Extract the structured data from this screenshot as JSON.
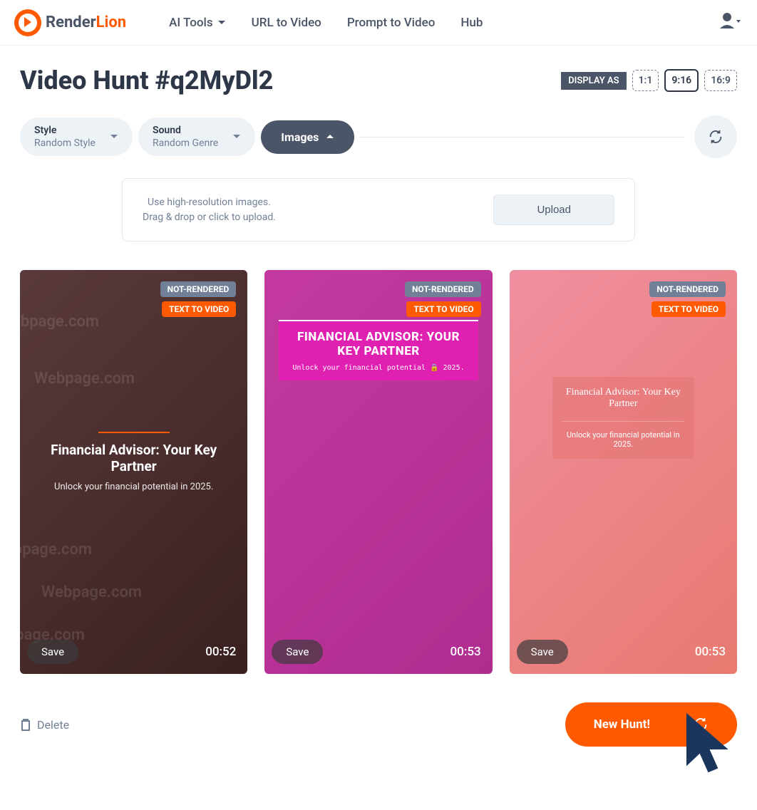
{
  "header": {
    "logo_render": "Render",
    "logo_lion": "Lion",
    "nav": [
      "AI Tools",
      "URL to Video",
      "Prompt to Video",
      "Hub"
    ]
  },
  "title": "Video Hunt #q2MyDl2",
  "display_as_label": "DISPLAY AS",
  "ratios": [
    "1:1",
    "9:16",
    "16:9"
  ],
  "filters": {
    "style_label": "Style",
    "style_value": "Random Style",
    "sound_label": "Sound",
    "sound_value": "Random Genre",
    "images_label": "Images"
  },
  "upload": {
    "line1": "Use high-resolution images.",
    "line2": "Drag & drop or click to upload.",
    "button": "Upload"
  },
  "cards": [
    {
      "status": "NOT-RENDERED",
      "type": "TEXT TO VIDEO",
      "duration": "00:52",
      "save": "Save",
      "title": "Financial Advisor: Your Key Partner",
      "subtitle": "Unlock your financial potential in 2025."
    },
    {
      "status": "NOT-RENDERED",
      "type": "TEXT TO VIDEO",
      "duration": "00:53",
      "save": "Save",
      "title": "FINANCIAL ADVISOR: YOUR KEY PARTNER",
      "subtitle": "Unlock your financial potential 🔒 2025."
    },
    {
      "status": "NOT-RENDERED",
      "type": "TEXT TO VIDEO",
      "duration": "00:53",
      "save": "Save",
      "title": "Financial Advisor: Your Key Partner",
      "subtitle": "Unlock your financial potential in 2025."
    }
  ],
  "footer": {
    "delete": "Delete",
    "new_hunt": "New Hunt!"
  },
  "watermark": "Webpage.com"
}
